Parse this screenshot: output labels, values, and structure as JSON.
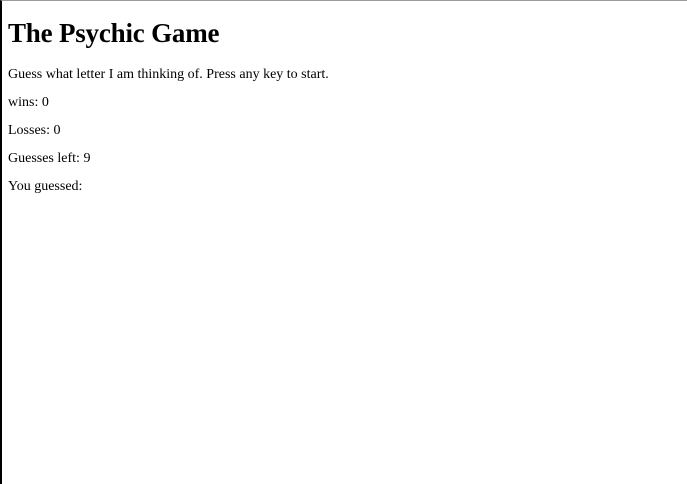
{
  "title": "The Psychic Game",
  "instructions": "Guess what letter I am thinking of. Press any key to start.",
  "stats": {
    "wins_label": "wins: ",
    "wins": "0",
    "losses_label": "Losses: ",
    "losses": "0",
    "guesses_left_label": "Guesses left: ",
    "guesses_left": "9",
    "guessed_label": "You guessed: ",
    "guessed": ""
  }
}
